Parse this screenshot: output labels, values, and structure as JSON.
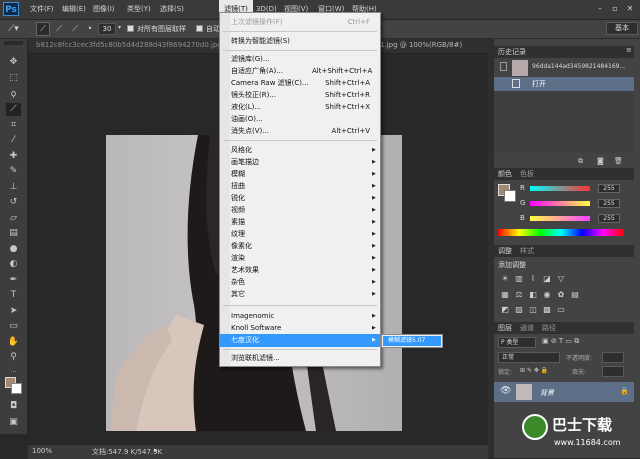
{
  "app": {
    "logo": "Ps"
  },
  "menubar": {
    "items": [
      "文件(F)",
      "编辑(E)",
      "图像(I)",
      "类型(Y)",
      "选择(S)",
      "滤镜(T)",
      "3D(D)",
      "视图(V)",
      "窗口(W)",
      "帮助(H)"
    ],
    "active": "滤镜(T)"
  },
  "options": {
    "size": "30",
    "sample_all_layers": "对所有图层取样",
    "auto_enhance": "自动",
    "workspace": "基本"
  },
  "document": {
    "tab_left": "b812c8fcc3cec3fd5c80b5d4d288d43f8694270d0.jpg",
    "tab_right": "1.jpg @ 100%(RGB/8#)"
  },
  "statusbar": {
    "zoom": "100%",
    "doc_size": "文档:547.9 K/547.9K"
  },
  "filter_menu": {
    "items": [
      {
        "label": "上次滤镜操作(F)",
        "shortcut": "Ctrl+F",
        "disabled": true
      },
      {
        "label": "转换为智能滤镜(S)",
        "shortcut": ""
      },
      {
        "label": "滤镜库(G)...",
        "shortcut": ""
      },
      {
        "label": "自适应广角(A)...",
        "shortcut": "Alt+Shift+Ctrl+A"
      },
      {
        "label": "Camera Raw 滤镜(C)...",
        "shortcut": "Shift+Ctrl+A"
      },
      {
        "label": "镜头校正(R)...",
        "shortcut": "Shift+Ctrl+R"
      },
      {
        "label": "液化(L)...",
        "shortcut": "Shift+Ctrl+X"
      },
      {
        "label": "油画(O)...",
        "shortcut": ""
      },
      {
        "label": "消失点(V)...",
        "shortcut": "Alt+Ctrl+V"
      },
      {
        "label": "风格化",
        "sub": true
      },
      {
        "label": "画笔描边",
        "sub": true
      },
      {
        "label": "模糊",
        "sub": true
      },
      {
        "label": "扭曲",
        "sub": true
      },
      {
        "label": "锐化",
        "sub": true
      },
      {
        "label": "视频",
        "sub": true
      },
      {
        "label": "素描",
        "sub": true
      },
      {
        "label": "纹理",
        "sub": true
      },
      {
        "label": "像素化",
        "sub": true
      },
      {
        "label": "渲染",
        "sub": true
      },
      {
        "label": "艺术效果",
        "sub": true
      },
      {
        "label": "杂色",
        "sub": true
      },
      {
        "label": "其它",
        "sub": true
      },
      {
        "label": "Imagenomic",
        "sub": true
      },
      {
        "label": "Knoll Software",
        "sub": true
      },
      {
        "label": "七度汉化",
        "sub": true,
        "highlighted": true
      },
      {
        "label": "浏览联机滤镜...",
        "shortcut": ""
      }
    ],
    "submenu_item": "模糊滤镜5.07"
  },
  "history": {
    "tab": "历史记录",
    "snapshot": "96dda144ad3459821484169...",
    "step": "打开"
  },
  "color": {
    "tabs": [
      "颜色",
      "色板"
    ],
    "channels": [
      {
        "name": "R",
        "value": "255"
      },
      {
        "name": "G",
        "value": "255"
      },
      {
        "name": "B",
        "value": "255"
      }
    ]
  },
  "adjustments": {
    "tabs": [
      "调整",
      "样式"
    ],
    "title": "添加调整"
  },
  "layers": {
    "tabs": [
      "图层",
      "通道",
      "路径"
    ],
    "kind": "P 类型",
    "blend": "正常",
    "opacity_label": "不透明度:",
    "lock_label": "锁定:",
    "fill_label": "填充:",
    "layer_name": "背景"
  },
  "watermark": {
    "brand": "巴士下载",
    "url": "www.11684.com"
  },
  "colors": {
    "accent": "#3399ff",
    "fg_swatch": "#a08a70"
  }
}
